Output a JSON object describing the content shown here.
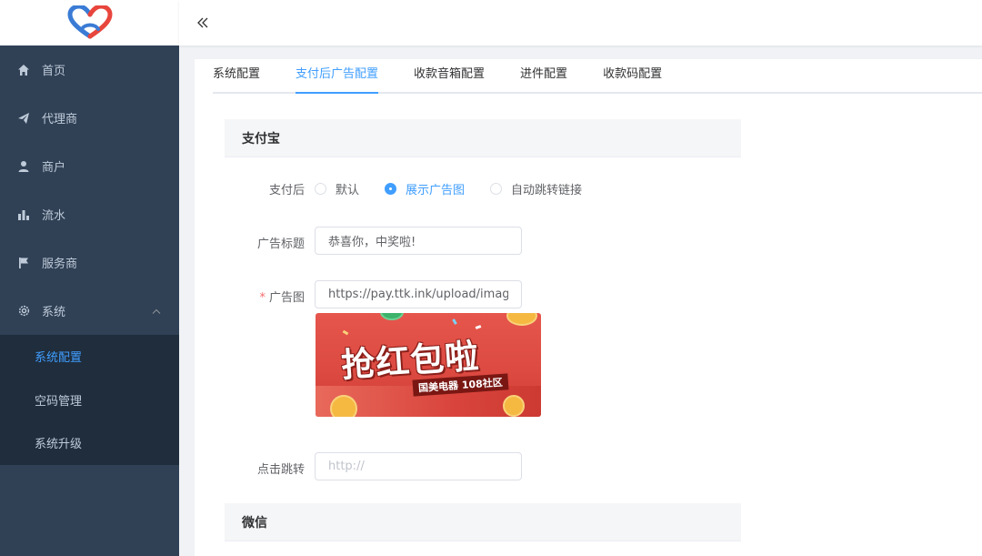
{
  "sidebar": {
    "items": [
      {
        "label": "首页"
      },
      {
        "label": "代理商"
      },
      {
        "label": "商户"
      },
      {
        "label": "流水"
      },
      {
        "label": "服务商"
      },
      {
        "label": "系统"
      }
    ],
    "submenu": [
      {
        "label": "系统配置"
      },
      {
        "label": "空码管理"
      },
      {
        "label": "系统升级"
      }
    ]
  },
  "tabs": [
    {
      "label": "系统配置"
    },
    {
      "label": "支付后广告配置"
    },
    {
      "label": "收款音箱配置"
    },
    {
      "label": "进件配置"
    },
    {
      "label": "收款码配置"
    }
  ],
  "alipay": {
    "section_title": "支付宝",
    "after_pay_label": "支付后",
    "radio_options": [
      {
        "label": "默认"
      },
      {
        "label": "展示广告图"
      },
      {
        "label": "自动跳转链接"
      }
    ],
    "ad_title_label": "广告标题",
    "ad_title_value": "恭喜你，中奖啦!",
    "ad_image_label": "广告图",
    "ad_image_required": "*",
    "ad_image_url": "https://pay.ttk.ink/upload/image/(",
    "ad_image_text": "抢红包啦",
    "ad_image_subtext": "国美电器 108社区",
    "click_jump_label": "点击跳转",
    "click_jump_placeholder": "http://"
  },
  "wechat": {
    "section_title": "微信"
  },
  "colors": {
    "sidebar_bg": "#304156",
    "submenu_bg": "#1f2d3d",
    "active": "#409eff",
    "logo_blue": "#3a7bd5",
    "logo_red": "#e8453c"
  }
}
